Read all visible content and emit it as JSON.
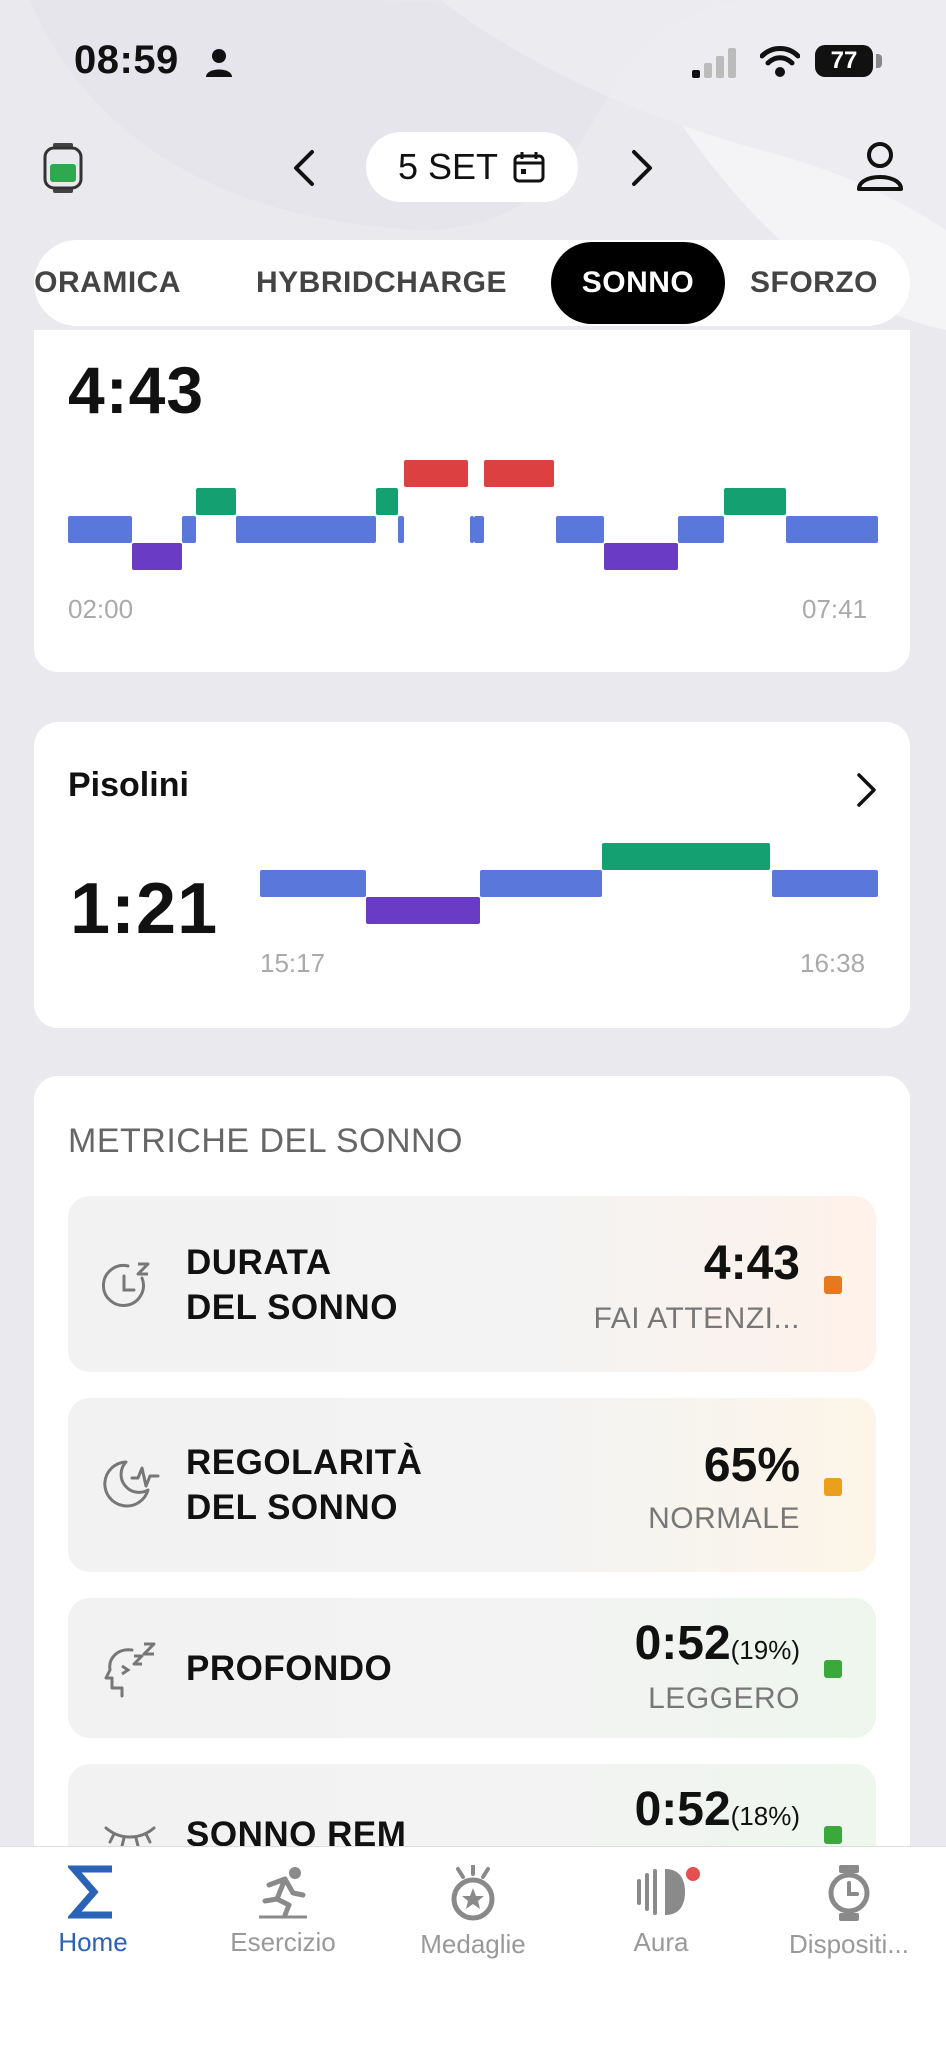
{
  "status_bar": {
    "time": "08:59",
    "battery": "77"
  },
  "header": {
    "date": "5 SET"
  },
  "tabs": [
    {
      "label": "NORAMICA",
      "active": false
    },
    {
      "label": "HYBRIDCHARGE",
      "active": false
    },
    {
      "label": "SONNO",
      "active": true
    },
    {
      "label": "SFORZO",
      "active": false
    }
  ],
  "sleep_card": {
    "total": "4:43",
    "start": "02:00",
    "end": "07:41"
  },
  "nap_card": {
    "title": "Pisolini",
    "total": "1:21",
    "start": "15:17",
    "end": "16:38"
  },
  "metrics": {
    "heading": "METRICHE DEL SONNO",
    "items": [
      {
        "label_line1": "DURATA",
        "label_line2": "DEL SONNO",
        "value": "4:43",
        "status": "FAI ATTENZI...",
        "dot_color": "#e8781e"
      },
      {
        "label_line1": "REGOLARITÀ",
        "label_line2": "DEL SONNO",
        "value": "65%",
        "status": "NORMALE",
        "dot_color": "#eaa01c"
      },
      {
        "label_line1": "PROFONDO",
        "value": "0:52",
        "percent": "(19%)",
        "status": "LEGGERO",
        "dot_color": "#3aa83a"
      },
      {
        "label_line1": "SONNO REM",
        "value": "0:52",
        "percent": "(18%)",
        "dot_color": "#3aa83a"
      }
    ]
  },
  "bottom_nav": [
    {
      "label": "Home",
      "icon": "sigma-icon",
      "active": true
    },
    {
      "label": "Esercizio",
      "icon": "running-icon",
      "active": false
    },
    {
      "label": "Medaglie",
      "icon": "medal-icon",
      "active": false
    },
    {
      "label": "Aura",
      "icon": "aura-icon",
      "active": false,
      "badge": true
    },
    {
      "label": "Dispositi...",
      "icon": "watch-icon",
      "active": false
    }
  ],
  "colors": {
    "light": "#5a78dc",
    "deep": "#6a3cc6",
    "rem": "#14a070",
    "awake": "#dc4040",
    "accent": "#2a62b8"
  }
}
